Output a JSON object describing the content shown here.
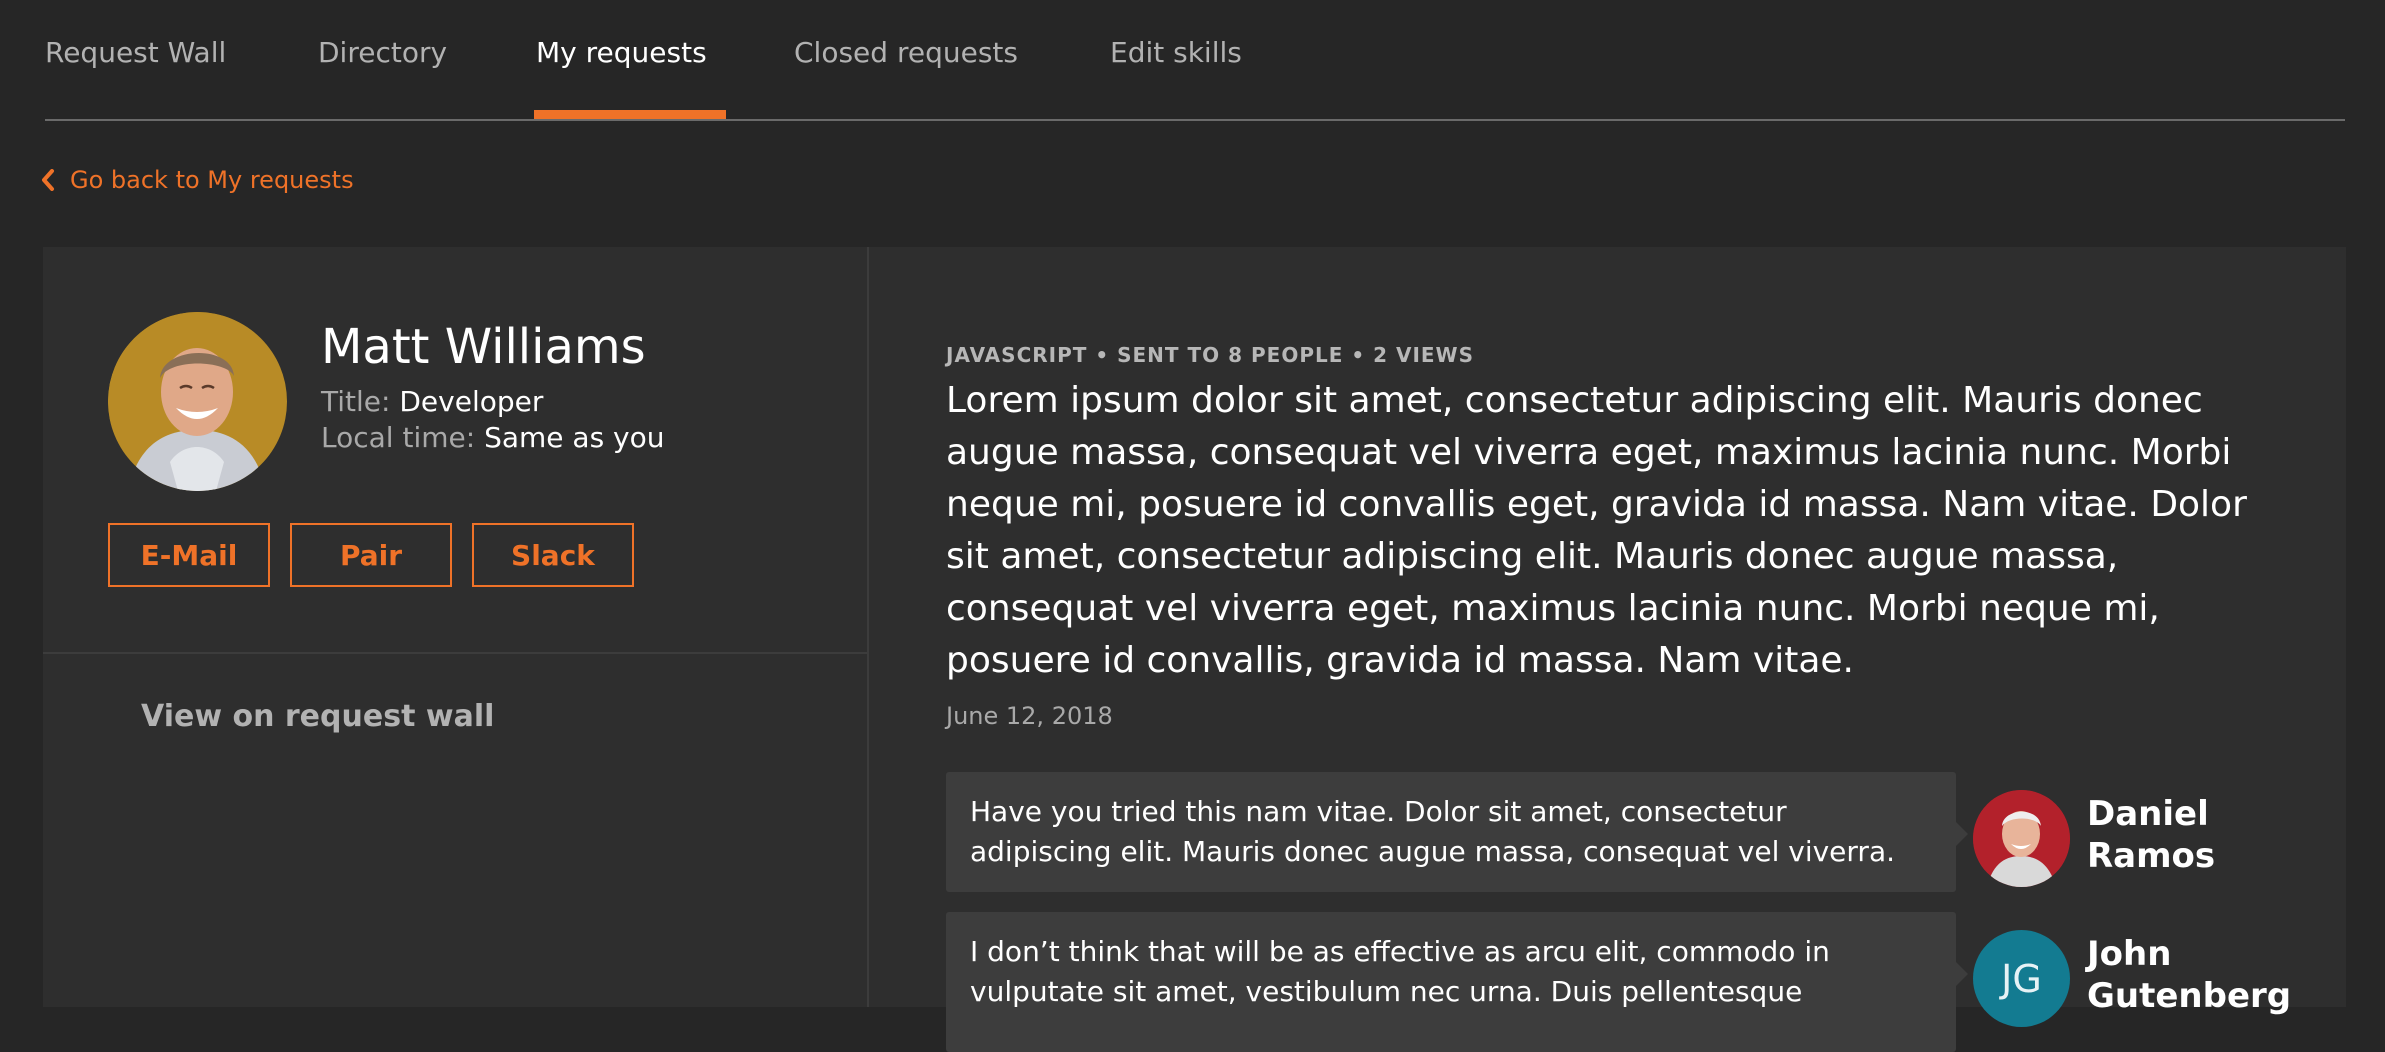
{
  "nav": {
    "tabs": [
      {
        "label": "Request Wall"
      },
      {
        "label": "Directory"
      },
      {
        "label": "My requests",
        "active": true
      },
      {
        "label": "Closed requests"
      },
      {
        "label": "Edit skills"
      }
    ]
  },
  "back_link": {
    "label": "Go back to My requests",
    "icon": "chevron-left-icon"
  },
  "profile": {
    "name": "Matt Williams",
    "title_label": "Title:",
    "title_value": "Developer",
    "time_label": "Local time:",
    "time_value": "Same as you",
    "buttons": {
      "email": "E-Mail",
      "pair": "Pair",
      "slack": "Slack"
    },
    "view_wall": "View on request wall"
  },
  "request": {
    "meta": "JAVASCRIPT • SENT TO 8 PEOPLE • 2 VIEWS",
    "text": "Lorem ipsum dolor sit amet, consectetur adipiscing elit. Mauris donec augue massa, consequat vel viverra eget, maximus lacinia nunc. Morbi neque mi, posuere id convallis eget, gravida id massa. Nam vitae. Dolor sit amet, consectetur adipiscing elit. Mauris donec augue massa, consequat vel viverra eget, maximus lacinia nunc. Morbi neque mi, posuere id convallis, gravida id massa. Nam vitae.",
    "date": "June 12, 2018"
  },
  "replies": [
    {
      "text": "Have you tried this nam vitae. Dolor sit amet, consectetur adipiscing elit. Mauris donec augue massa, consequat vel viverra.",
      "author": "Daniel Ramos"
    },
    {
      "text": "I don’t think that will be as effective as arcu elit, commodo in vulputate sit amet, vestibulum nec urna. Duis pellentesque",
      "author": "John Gutenberg",
      "initials": "JG"
    }
  ],
  "colors": {
    "accent": "#ef7228",
    "background": "#262626",
    "panel": "#2e2e2e",
    "bubble": "#3d3d3d",
    "avatar_main": "#b88b26",
    "avatar_daniel": "#b3212b",
    "avatar_john": "#137b91"
  }
}
